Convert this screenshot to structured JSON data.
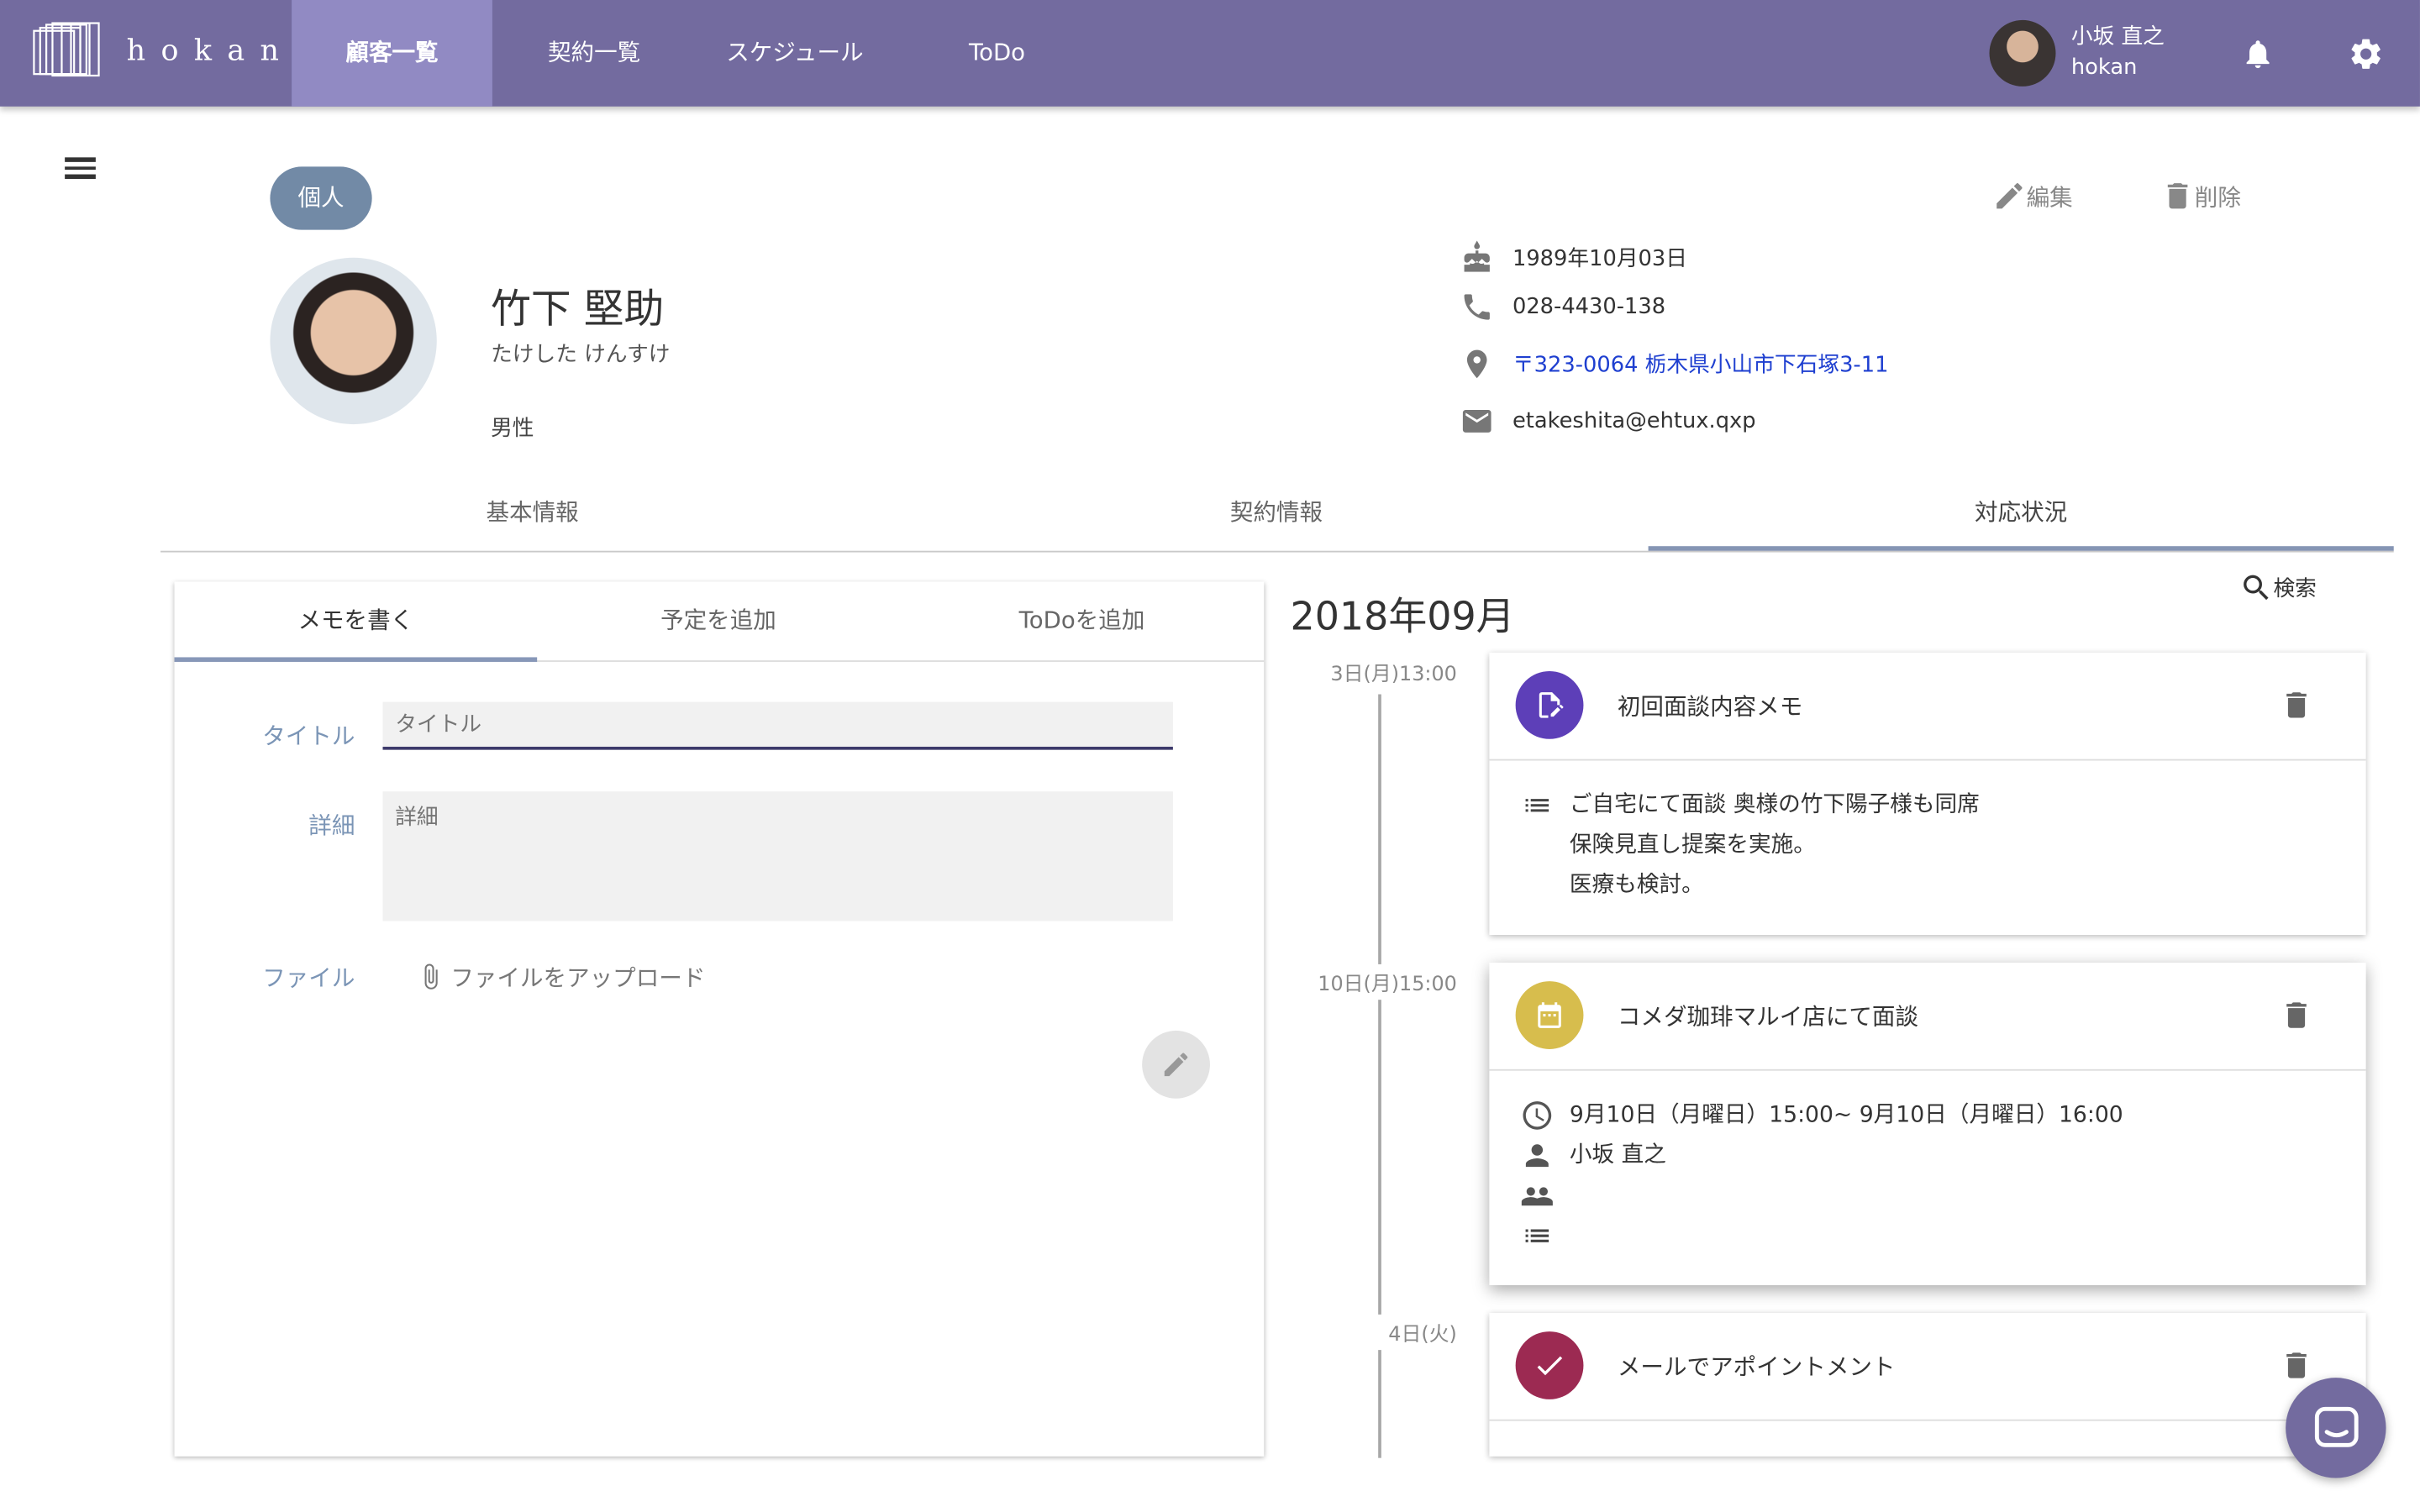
{
  "app": {
    "logo_text": "hokan",
    "nav": [
      {
        "label": "顧客一覧",
        "active": true
      },
      {
        "label": "契約一覧",
        "active": false
      },
      {
        "label": "スケジュール",
        "active": false
      },
      {
        "label": "ToDo",
        "active": false
      }
    ],
    "user": {
      "name": "小坂 直之",
      "org": "hokan"
    },
    "colors": {
      "topbar": "#736b9f",
      "nav_active": "#918ac3",
      "chip": "#728aa6",
      "link": "#1e3fd0"
    }
  },
  "customer": {
    "type_chip": "個人",
    "name": "竹下 堅助",
    "kana": "たけした けんすけ",
    "gender": "男性",
    "birthday": "1989年10月03日",
    "phone": "028-4430-138",
    "address": "〒323-0064 栃木県小山市下石塚3-11",
    "email": "etakeshita@ehtux.qxp",
    "edit_label": "編集",
    "delete_label": "削除"
  },
  "tabs": {
    "items": [
      "基本情報",
      "契約情報",
      "対応状況"
    ],
    "active_index": 2
  },
  "memo": {
    "subtabs": [
      "メモを書く",
      "予定を追加",
      "ToDoを追加"
    ],
    "title_label": "タイトル",
    "title_placeholder": "タイトル",
    "detail_label": "詳細",
    "detail_placeholder": "詳細",
    "file_label": "ファイル",
    "upload_label": "ファイルをアップロード"
  },
  "timeline": {
    "month": "2018年09月",
    "search_label": "検索",
    "entries": [
      {
        "date": "3日(月)13:00",
        "title": "初回面談内容メモ",
        "icon": "memo-edit-icon",
        "color": "#5d3fb8",
        "lines": [
          "ご自宅にて面談 奥様の竹下陽子様も同席",
          "保険見直し提案を実施。",
          "医療も検討。"
        ]
      },
      {
        "date": "10日(月)15:00",
        "title": "コメダ珈琲マルイ店にて面談",
        "icon": "calendar-icon",
        "color": "#d7bd4d",
        "time": "9月10日（月曜日）15:00~ 9月10日（月曜日）16:00",
        "person": "小坂 直之"
      },
      {
        "date": "4日(火)",
        "title": "メールでアポイントメント",
        "icon": "check-icon",
        "color": "#9c2a52"
      }
    ]
  }
}
